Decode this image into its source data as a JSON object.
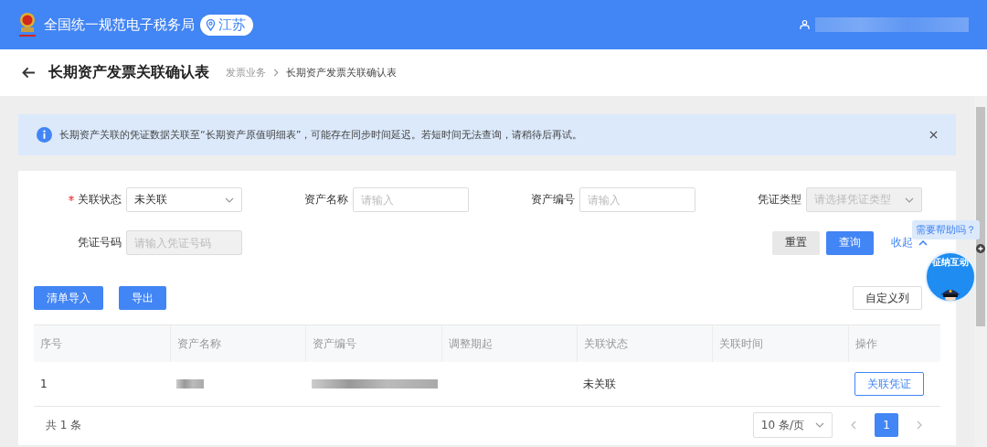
{
  "header": {
    "site_title": "全国统一规范电子税务局",
    "region": "江苏"
  },
  "page": {
    "title": "长期资产发票关联确认表",
    "breadcrumb": [
      {
        "label": "发票业务",
        "current": false
      },
      {
        "label": "长期资产发票关联确认表",
        "current": true
      }
    ]
  },
  "alert": {
    "message": "长期资产关联的凭证数据关联至“长期资产原值明细表”，可能存在同步时间延迟。若短时间无法查询，请稍待后再试。"
  },
  "filters": [
    {
      "label": "关联状态",
      "kind": "select",
      "required": true,
      "disabled": false,
      "value": "未关联"
    },
    {
      "label": "资产名称",
      "kind": "input",
      "required": false,
      "disabled": false,
      "placeholder": "请输入"
    },
    {
      "label": "资产编号",
      "kind": "input",
      "required": false,
      "disabled": false,
      "placeholder": "请输入"
    },
    {
      "label": "凭证类型",
      "kind": "select",
      "required": false,
      "disabled": true,
      "placeholder": "请选择凭证类型"
    },
    {
      "label": "凭证号码",
      "kind": "input",
      "required": false,
      "disabled": true,
      "placeholder": "请输入凭证号码"
    }
  ],
  "filter_actions": {
    "reset": "重置",
    "search": "查询",
    "collapse": "收起"
  },
  "toolbar": {
    "left": [
      "清单导入",
      "导出"
    ],
    "right": "自定义列"
  },
  "table": {
    "columns": [
      "序号",
      "资产名称",
      "资产编号",
      "调整期起",
      "关联状态",
      "关联时间",
      "操作"
    ],
    "rows": [
      {
        "index": "1",
        "status": "未关联",
        "action": "关联凭证"
      }
    ]
  },
  "pagination": {
    "total": "共 1 条",
    "page_size": "10 条/页",
    "pages": [
      {
        "label": "1",
        "selected": true
      }
    ]
  },
  "assistant": {
    "bubble": "需要帮助吗？",
    "badge": "征纳互动"
  }
}
